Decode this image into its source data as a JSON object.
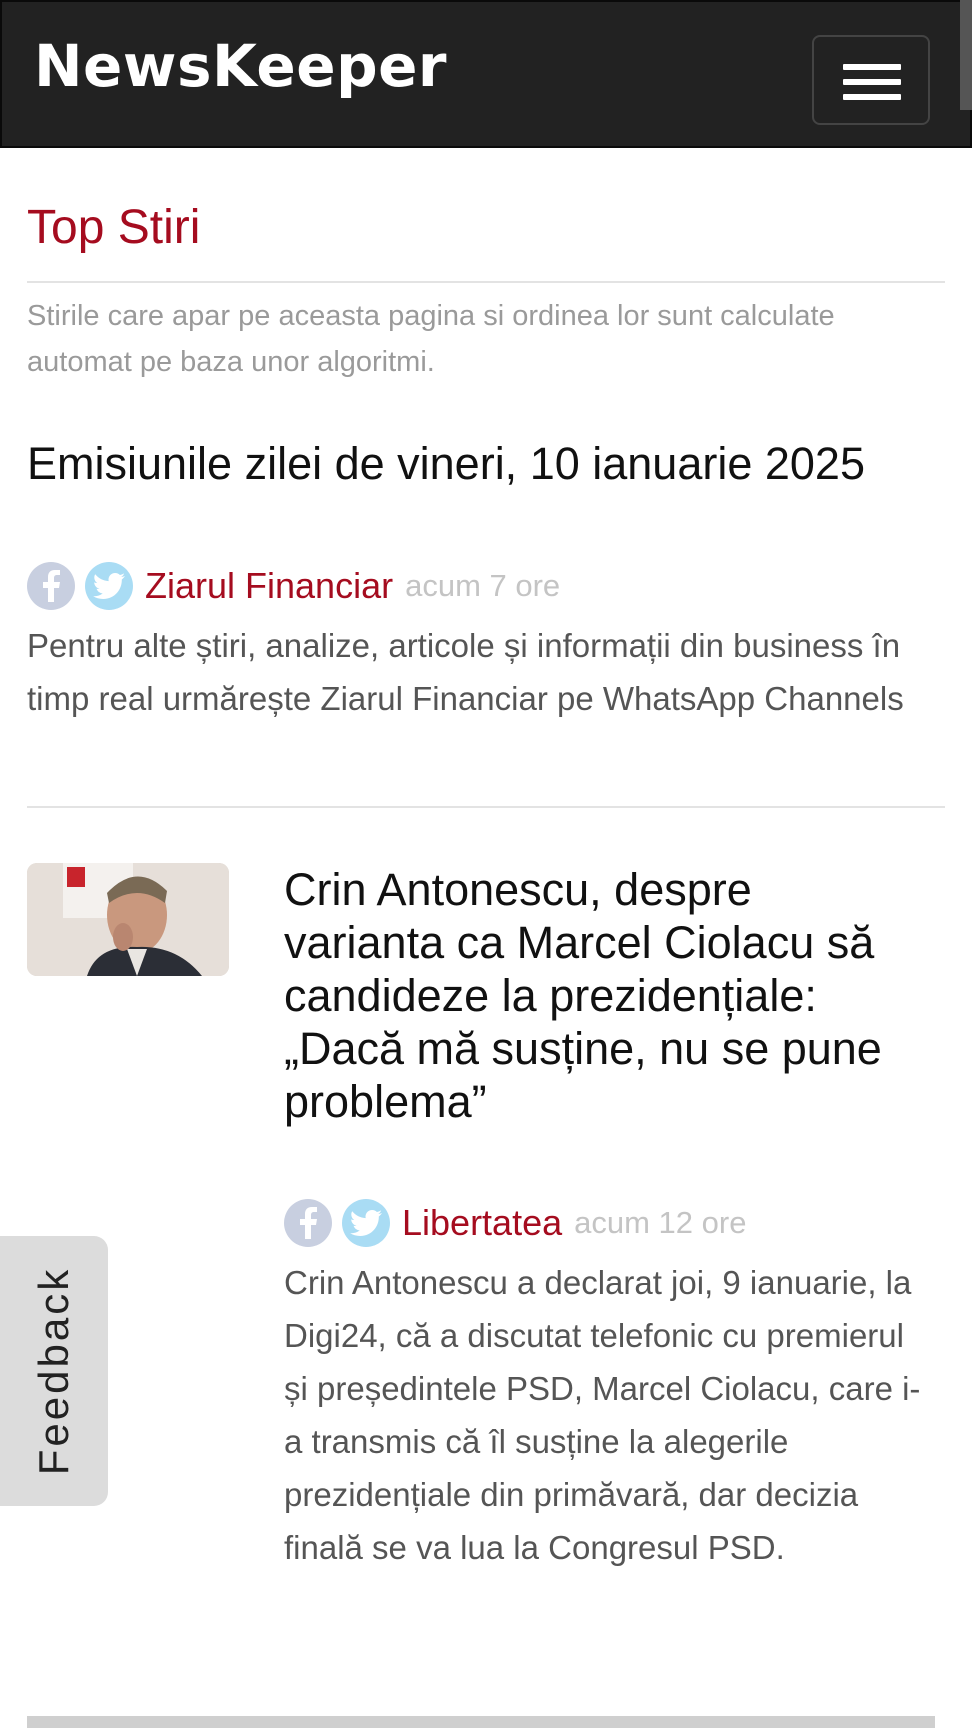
{
  "navbar": {
    "brand": "NewsKeeper",
    "menu_icon": "hamburger-menu-icon"
  },
  "page": {
    "title": "Top Stiri",
    "intro": "Stirile care apar pe aceasta pagina si ordinea lor sunt calculate automat pe baza unor algoritmi."
  },
  "articles": [
    {
      "headline": "Emisiunile zilei de vineri, 10 ianuarie 2025",
      "source": "Ziarul Financiar",
      "time": "acum 7 ore",
      "summary": "Pentru alte știri, analize, articole și informații din business în timp real urmărește Ziarul Financiar pe WhatsApp Channels",
      "icons": [
        "facebook-share-icon",
        "twitter-share-icon"
      ]
    },
    {
      "headline": "Crin Antonescu, despre varianta ca Marcel Ciolacu să candideze la prezidențiale: „Dacă mă susține, nu se pune problema”",
      "source": "Libertatea",
      "time": "acum 12 ore",
      "summary": "Crin Antonescu a declarat joi, 9 ianuarie, la Digi24, că a discutat telefonic cu premierul și președintele PSD, Marcel Ciolacu, care i-a transmis că îl susține la alegerile prezidențiale din primăvară, dar decizia finală se va lua la Congresul PSD.",
      "thumbnail": "news-thumbnail-photo",
      "icons": [
        "facebook-share-icon",
        "twitter-share-icon"
      ]
    }
  ],
  "feedback": {
    "label": "Feedback"
  },
  "colors": {
    "brand_red": "#a50c1f",
    "navbar_bg": "#222222",
    "facebook_icon_bg": "#c8cfe0",
    "twitter_icon_bg": "#a9dcf4"
  }
}
